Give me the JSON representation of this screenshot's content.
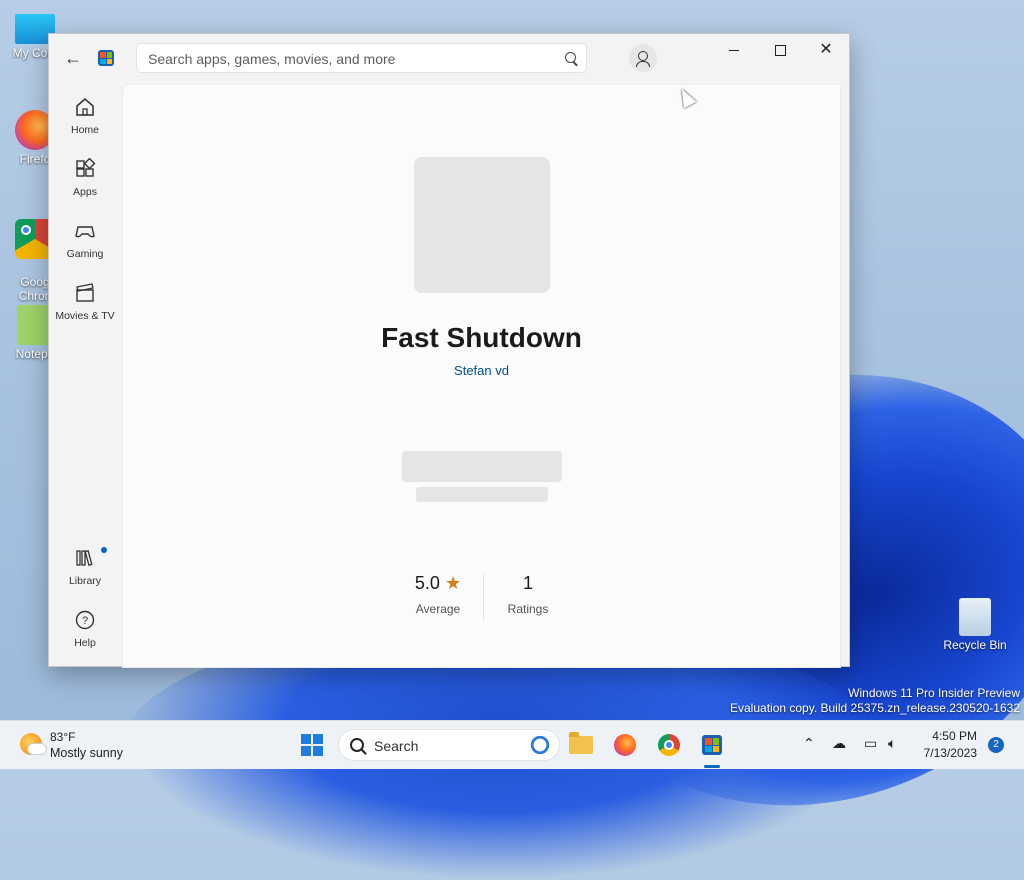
{
  "desktop": {
    "icons": [
      {
        "label": "My Com"
      },
      {
        "label": "Firefo"
      },
      {
        "label": "Goog\nChron"
      },
      {
        "label": "Notepa"
      },
      {
        "label": "Recycle Bin"
      }
    ],
    "watermark": {
      "line1": "Windows 11 Pro Insider Preview",
      "line2": "Evaluation copy. Build 25375.zn_release.230520-1632"
    }
  },
  "store": {
    "search": {
      "placeholder": "Search apps, games, movies, and more"
    },
    "nav": [
      {
        "label": "Home",
        "icon": "home-icon"
      },
      {
        "label": "Apps",
        "icon": "apps-icon"
      },
      {
        "label": "Gaming",
        "icon": "gaming-icon"
      },
      {
        "label": "Movies & TV",
        "icon": "movies-icon"
      },
      {
        "label": "Library",
        "icon": "library-icon"
      },
      {
        "label": "Help",
        "icon": "help-icon"
      }
    ],
    "app": {
      "title": "Fast Shutdown",
      "publisher": "Stefan vd",
      "rating": {
        "value": "5.0",
        "label": "Average"
      },
      "ratings_count": {
        "value": "1",
        "label": "Ratings"
      }
    }
  },
  "taskbar": {
    "weather": {
      "temp": "83°F",
      "desc": "Mostly sunny"
    },
    "search_label": "Search",
    "clock": {
      "time": "4:50 PM",
      "date": "7/13/2023"
    },
    "notifications": "2"
  },
  "colors": {
    "accent": "#0067c0",
    "publisher_link": "#00508e",
    "star": "#d87b1b"
  }
}
